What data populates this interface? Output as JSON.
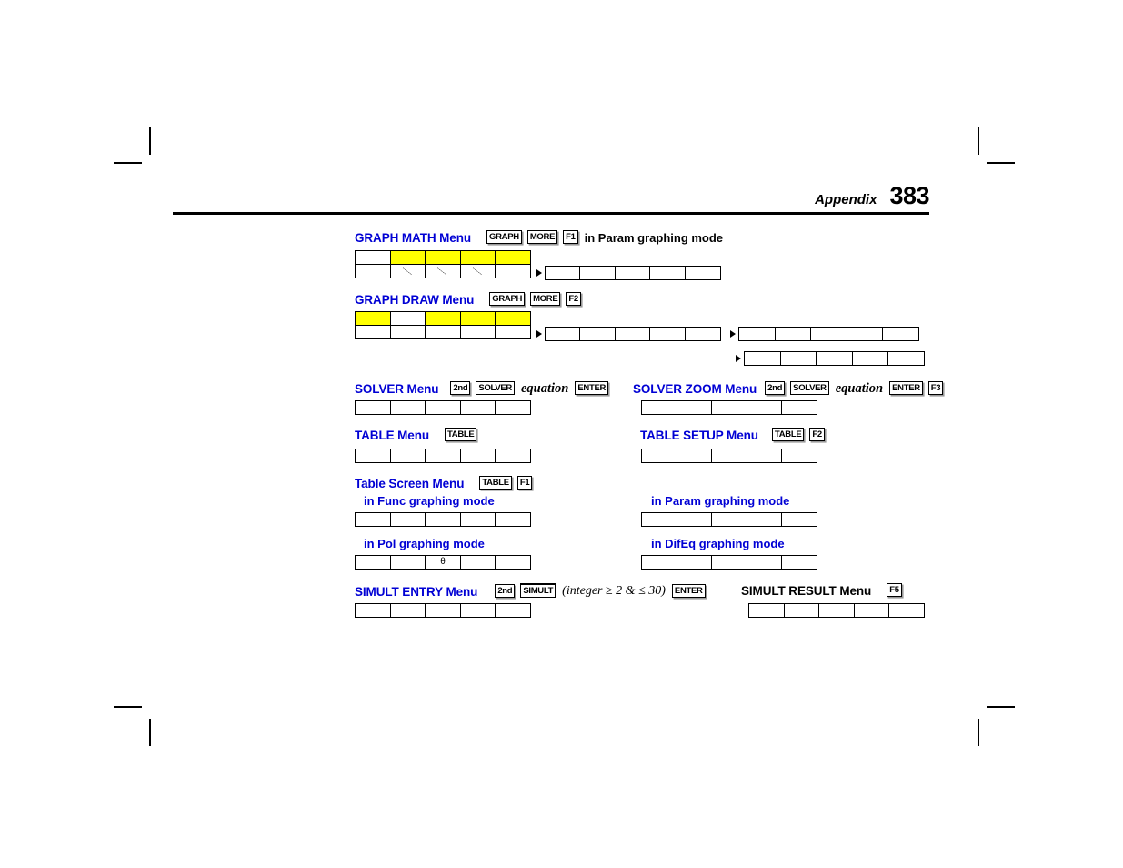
{
  "page": {
    "header_label": "Appendix",
    "page_number": "383"
  },
  "sections": [
    {
      "id": "graph-math",
      "title": "GRAPH MATH Menu",
      "title_color": "#0000d4",
      "keys": [
        "GRAPH",
        "MORE",
        "F1"
      ],
      "note": "in Param graphing mode"
    },
    {
      "id": "graph-draw",
      "title": "GRAPH DRAW Menu",
      "title_color": "#0000d4",
      "keys": [
        "GRAPH",
        "MORE",
        "F2"
      ],
      "note": ""
    },
    {
      "id": "solver",
      "title": "SOLVER Menu",
      "title_color": "#0000d4",
      "keys": [
        "2nd",
        "SOLVER",
        "ENTER"
      ],
      "variable": "equation"
    },
    {
      "id": "solver-zoom",
      "title": "SOLVER ZOOM Menu",
      "title_color": "#0000d4",
      "keys": [
        "2nd",
        "SOLVER",
        "ENTER",
        "F3"
      ],
      "variable": "equation"
    },
    {
      "id": "table",
      "title": "TABLE Menu",
      "title_color": "#0000d4",
      "keys": [
        "TABLE"
      ]
    },
    {
      "id": "table-setup",
      "title": "TABLE SETUP Menu",
      "title_color": "#0000d4",
      "keys": [
        "TABLE",
        "F2"
      ]
    },
    {
      "id": "table-screen",
      "title": "Table Screen Menu",
      "title_color": "#0000d4",
      "keys": [
        "TABLE",
        "F1"
      ],
      "modes": [
        "in Func graphing mode",
        "in Param graphing mode",
        "in Pol graphing mode",
        "in DifEq graphing mode"
      ]
    },
    {
      "id": "simult-entry",
      "title": "SIMULT ENTRY Menu",
      "title_color": "#0000d4",
      "keys": [
        "2nd",
        "SIMULT",
        "ENTER"
      ],
      "condition": "(integer ≥ 2 & ≤ 30)"
    },
    {
      "id": "simult-result",
      "title": "SIMULT RESULT Menu",
      "title_color": "#000000",
      "keys": [
        "F5"
      ]
    }
  ],
  "labels": {
    "graph_math_title": "GRAPH MATH Menu",
    "graph_math_note": "in Param graphing mode",
    "graph_draw_title": "GRAPH DRAW Menu",
    "solver_title": "SOLVER Menu",
    "solver_zoom_title": "SOLVER ZOOM Menu",
    "table_title": "TABLE Menu",
    "table_setup_title": "TABLE SETUP Menu",
    "table_screen_title": "Table Screen Menu",
    "mode_func": "in Func graphing mode",
    "mode_param": "in Param graphing mode",
    "mode_pol": "in Pol graphing mode",
    "mode_difeq": "in DifEq graphing mode",
    "simult_entry_title": "SIMULT ENTRY Menu",
    "simult_result_title": "SIMULT RESULT Menu",
    "simult_condition": "(integer ≥ 2 & ≤ 30)",
    "equation_word": "equation",
    "theta_glyph": "θ"
  },
  "keycaps": {
    "graph": "GRAPH",
    "more": "MORE",
    "f1": "F1",
    "f2": "F2",
    "f3": "F3",
    "f5": "F5",
    "second": "2nd",
    "solver": "SOLVER",
    "enter": "ENTER",
    "table": "TABLE",
    "simult": "SIMULT"
  },
  "colors": {
    "heading_blue": "#0000d4",
    "highlight_yellow": "#ffff00",
    "ink": "#000000",
    "key_shadow": "#9a9a9a"
  },
  "menu_strips": {
    "graph_math": {
      "primary": {
        "top": [
          {
            "hl": false
          },
          {
            "hl": true
          },
          {
            "hl": true
          },
          {
            "hl": true
          },
          {
            "hl": true
          }
        ],
        "bottom": [
          {
            "slash": false
          },
          {
            "slash": true
          },
          {
            "slash": true
          },
          {
            "slash": true
          },
          {
            "slash": false
          }
        ]
      },
      "continuation": [
        5
      ]
    },
    "graph_draw": {
      "primary": {
        "top": [
          {
            "hl": true
          },
          {
            "hl": false
          },
          {
            "hl": true
          },
          {
            "hl": true
          },
          {
            "hl": true
          }
        ],
        "bottom": [
          {
            "slash": false
          },
          {
            "slash": false
          },
          {
            "slash": false
          },
          {
            "slash": false
          },
          {
            "slash": false
          }
        ]
      },
      "continuation_row1": [
        5,
        5
      ],
      "continuation_row2": [
        5
      ]
    },
    "solver": {
      "cells": 5
    },
    "solver_zoom": {
      "cells": 5
    },
    "table": {
      "cells": 5
    },
    "table_setup": {
      "cells": 5
    },
    "table_func": {
      "cells": 5
    },
    "table_param": {
      "cells": 5
    },
    "table_pol": {
      "cells": 5,
      "glyph_index": 2,
      "glyph": "θ"
    },
    "table_difeq": {
      "cells": 5
    },
    "simult_entry": {
      "cells": 5
    },
    "simult_result": {
      "cells": 5
    }
  }
}
